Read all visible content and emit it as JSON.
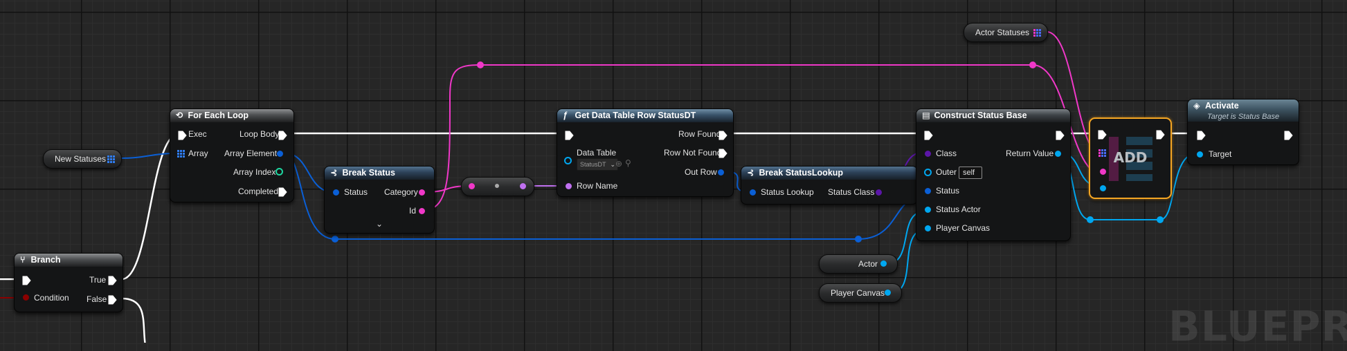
{
  "watermark": "BLUEPRIN",
  "variables": {
    "new_statuses": "New Statuses",
    "actor_statuses": "Actor Statuses",
    "actor": "Actor",
    "player_canvas": "Player Canvas"
  },
  "branch": {
    "title": "Branch",
    "pins": {
      "true": "True",
      "condition": "Condition",
      "false": "False"
    }
  },
  "for_each_loop": {
    "title": "For Each Loop",
    "pins": {
      "exec": "Exec",
      "array": "Array",
      "loop_body": "Loop Body",
      "array_element": "Array Element",
      "array_index": "Array Index",
      "completed": "Completed"
    }
  },
  "break_status": {
    "title": "Break Status",
    "pins": {
      "status": "Status",
      "category": "Category",
      "id": "Id"
    }
  },
  "get_data_table_row": {
    "title": "Get Data Table Row StatusDT",
    "pins": {
      "data_table": "Data Table",
      "data_table_value": "StatusDT",
      "row_name": "Row Name",
      "row_found": "Row Found",
      "row_not_found": "Row Not Found",
      "out_row": "Out Row"
    }
  },
  "break_status_lookup": {
    "title": "Break StatusLookup",
    "pins": {
      "status_lookup": "Status Lookup",
      "status_class": "Status Class"
    }
  },
  "construct_status_base": {
    "title": "Construct Status Base",
    "pins": {
      "class": "Class",
      "outer": "Outer",
      "outer_value": "self",
      "status": "Status",
      "status_actor": "Status Actor",
      "player_canvas": "Player Canvas",
      "return_value": "Return Value"
    }
  },
  "add_node": {
    "label": "ADD"
  },
  "activate": {
    "title": "Activate",
    "subtitle": "Target is Status Base",
    "pins": {
      "target": "Target"
    }
  },
  "colors": {
    "exec": "#ffffff",
    "struct": "#0a5fd6",
    "object": "#00a7f0",
    "name": "#f038c8",
    "string": "#f038c8",
    "class": "#5b16a8",
    "int": "#1ed6a0",
    "bool": "#8c0000",
    "highlight": "#f5a623"
  }
}
